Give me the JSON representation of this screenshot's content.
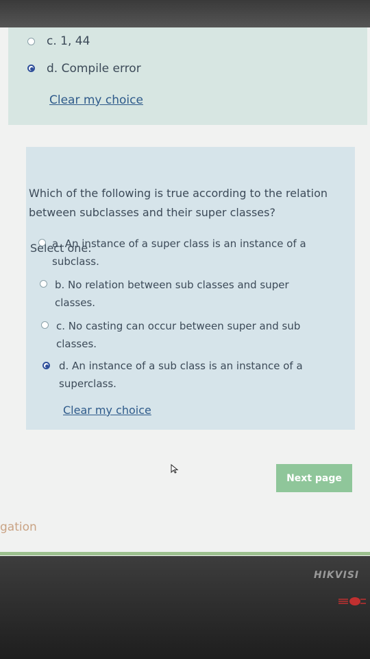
{
  "prev_question": {
    "options": [
      {
        "label": "c. 1, 44",
        "checked": false
      },
      {
        "label": "d. Compile error",
        "checked": true
      }
    ],
    "clear_label": "Clear my choice"
  },
  "question": {
    "text": "Which of the following is true according to the relation between subclasses and their super classes?",
    "select_one": "Select one:",
    "options": [
      {
        "line1": "a. An instance of a super class is an instance of a",
        "line2": "subclass.",
        "checked": false
      },
      {
        "line1": "b. No relation between sub classes and super",
        "line2": "classes.",
        "checked": false
      },
      {
        "line1": "c. No casting can occur between super and sub",
        "line2": "classes.",
        "checked": false
      },
      {
        "line1": "d. An instance of a sub class is an instance of a",
        "line2": "superclass.",
        "checked": true
      }
    ],
    "clear_label": "Clear my choice"
  },
  "next_page_label": "Next page",
  "nav_fragment": "gation",
  "monitor_brand": "HIKVISI"
}
